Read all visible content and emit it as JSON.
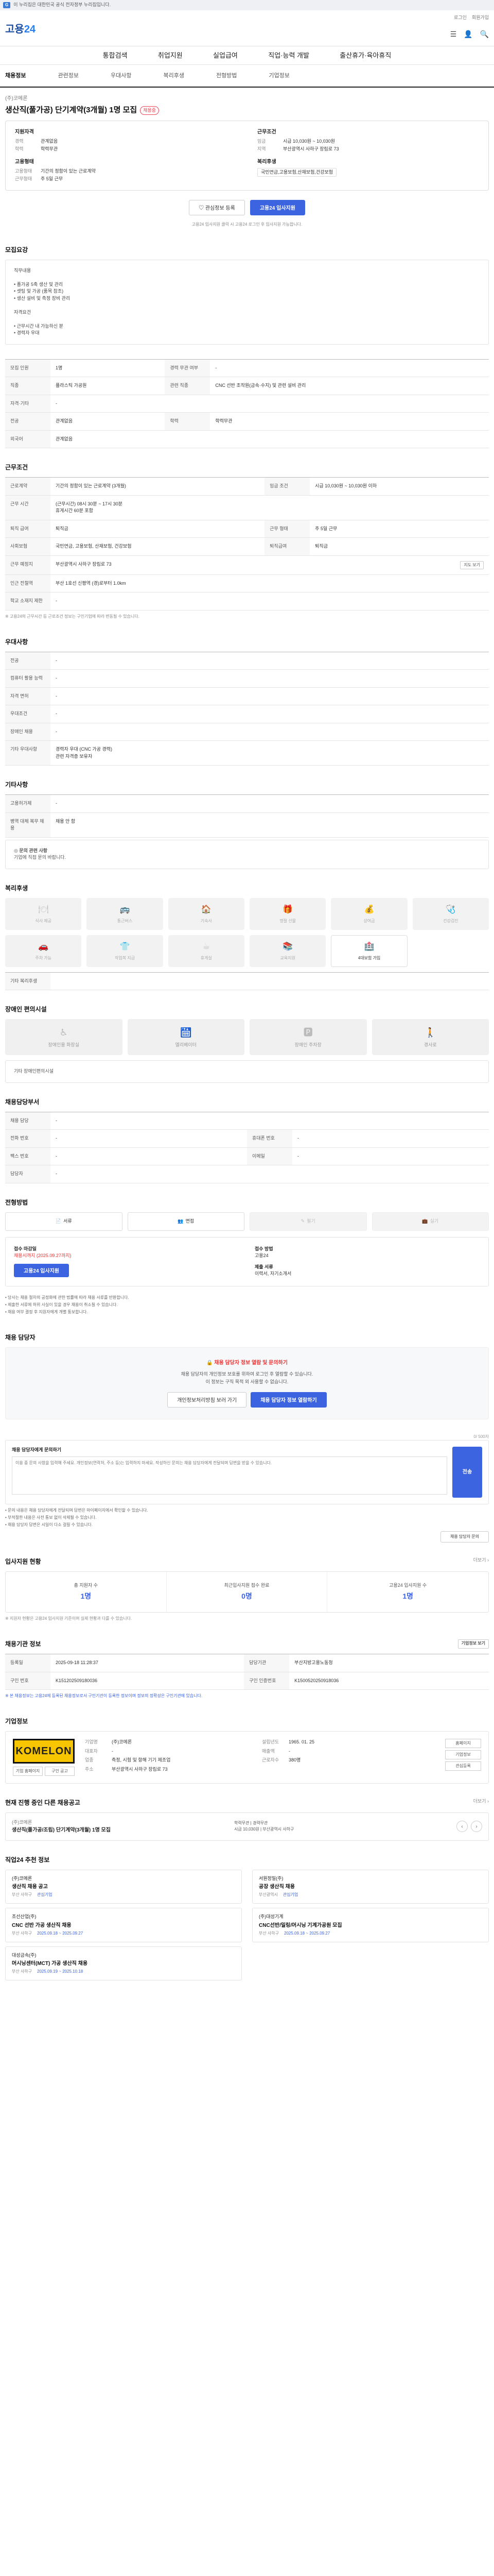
{
  "topbar": {
    "badge": "G",
    "text": "이 누리집은 대한민국 공식 전자정부 누리집입니다."
  },
  "header": {
    "logo_prefix": "고용",
    "logo_suffix": "24",
    "util": [
      "로그인",
      "회원가입"
    ],
    "icons": [
      "☰",
      "👤",
      "🔍"
    ]
  },
  "gnb": [
    "통합검색",
    "취업지원",
    "실업급여",
    "직업·능력 개발",
    "출산휴가·육아휴직"
  ],
  "subnav": [
    "채용정보",
    "관련정보",
    "우대사항",
    "복리후생",
    "전형방법",
    "기업정보"
  ],
  "job": {
    "company": "(주)코메론",
    "tag": "채용중",
    "title": "생산직(풀가공) 단기계약(3개월) 1명 모집",
    "qual_title": "지원자격",
    "qual": [
      [
        "경력",
        "관계없음"
      ],
      [
        "학력",
        "학력무관"
      ]
    ],
    "cond_title": "근무조건",
    "cond": [
      [
        "임금",
        "시급 10,030원 ~ 10,030원"
      ],
      [
        "지역",
        "부산광역시 사하구 장림로 73"
      ]
    ],
    "emp_title": "고용형태",
    "emp": [
      [
        "고용형태",
        "기간의 정함이 있는 근로계약"
      ],
      [
        "근무형태",
        "주 5일 근무"
      ]
    ],
    "welfare_title": "복리후생",
    "welfare": "국민연금,고용보험,산재보험,건강보험"
  },
  "buttons": {
    "scrap": "♡ 관심정보 등록",
    "apply": "고용24 입사지원"
  },
  "apply_note": "고용24 입사지원 클릭 시 고용24 로그인 후 입사지원 가능합니다.",
  "apply_note_link": "고용24 입사지원",
  "sections": {
    "detail": {
      "title": "모집요강",
      "text": "직무내용\n\n• 폴가공 5축 생산 및 관리\n• 셋팅 및 가공 (품목 참조)\n• 생산 설비 및 측정 장비 관리\n\n자격요건\n\n• 근무시간 내 가능하신 분\n• 경력자 우대"
    },
    "summary": {
      "title": "모집요강 요약",
      "rows": [
        [
          "모집 인원",
          "1명",
          "경력 무관 여부",
          "-"
        ],
        [
          "직종",
          "플라스틱 가공원",
          "관련 직종",
          "CNC 선반 조작원(금속·수지) 및 관련 설비 관리"
        ],
        [
          "자격·기타",
          "-",
          "",
          ""
        ],
        [
          "전공",
          "관계없음",
          "학력",
          "학력무관"
        ],
        [
          "외국어",
          "관계없음",
          "",
          ""
        ]
      ]
    },
    "work": {
      "title": "근무조건",
      "rows": [
        [
          "근로계약",
          "기간의 정함이 있는 근로계약 (3개월)",
          "임금 조건",
          "시급 10,030원 ~ 10,030원 이하"
        ],
        [
          "근무 시간",
          "(근무시간) 08시 30분 ~ 17시 30분\n휴게시간 60분 포함",
          "",
          ""
        ],
        [
          "퇴직 급여",
          "퇴직금",
          "근무 형태",
          "주 5일 근무"
        ],
        [
          "사회보험",
          "국민연금, 고용보험, 산재보험, 건강보험",
          "퇴직급여",
          "퇴직금"
        ],
        [
          "근무 예정지",
          "부산광역시 사하구 장림로 73",
          "",
          ""
        ],
        [
          "인근 전철역",
          "부산 1호선 신평역 (경)로부터 1.0km",
          "",
          ""
        ],
        [
          "학교 소재지 제한",
          "-",
          "",
          ""
        ]
      ],
      "map_btn": "지도 보기",
      "note": "※ 고용24의 근무시간 등 근로조건 정보는 구인기업에 따라 변동될 수 있습니다."
    },
    "pref": {
      "title": "우대사항",
      "rows": [
        [
          "전공",
          "-"
        ],
        [
          "컴퓨터 활용 능력",
          "-"
        ],
        [
          "자격 면허",
          "-"
        ],
        [
          "우대조건",
          "-"
        ],
        [
          "장애인 채용",
          "-"
        ],
        [
          "기타 우대사항",
          "경력자 우대 (CNC 가공 경력)\n관련 자격증 보유자"
        ]
      ]
    },
    "etc": {
      "title": "기타사항",
      "rows": [
        [
          "고용허가제",
          "-"
        ],
        [
          "병역 대체 복무 채용",
          "채용 안 함"
        ]
      ],
      "inquiry_title": "◎ 문의 관련 사항",
      "inquiry": "기업에 직접 문의 바랍니다."
    },
    "welfare": {
      "title": "복리후생",
      "items": [
        [
          "🍽",
          "식사 제공",
          false
        ],
        [
          "🚌",
          "통근버스",
          false
        ],
        [
          "🏠",
          "기숙사",
          false
        ],
        [
          "🎁",
          "명절 선물",
          false
        ],
        [
          "💰",
          "상여금",
          false
        ],
        [
          "🩺",
          "건강검진",
          false
        ],
        [
          "🚗",
          "주차 가능",
          false
        ],
        [
          "👕",
          "작업복 지급",
          false
        ],
        [
          "☕",
          "휴게실",
          false
        ],
        [
          "📚",
          "교육지원",
          false
        ],
        [
          "🏥",
          "4대보험 가입",
          true
        ]
      ],
      "other_title": "기타 복리후생"
    },
    "barrier": {
      "title": "장애인 편의시설",
      "items": [
        [
          "♿",
          "장애인용 화장실"
        ],
        [
          "🛗",
          "엘리베이터"
        ],
        [
          "🅿",
          "장애인 주차장"
        ],
        [
          "🚶",
          "경사로"
        ]
      ],
      "other_title": "기타 장애인편의시설"
    },
    "dept": {
      "title": "채용담당부서",
      "rows": [
        [
          "채용 담당",
          "-",
          "",
          ""
        ],
        [
          "전화 번호",
          "-",
          "휴대폰 번호",
          "-"
        ],
        [
          "팩스 번호",
          "-",
          "이메일",
          "-"
        ],
        [
          "담당자",
          "-",
          "",
          ""
        ]
      ]
    },
    "method": {
      "title": "전형방법",
      "buttons": [
        [
          "📄",
          "서류",
          true
        ],
        [
          "👥",
          "면접",
          true
        ],
        [
          "✎",
          "필기",
          false
        ],
        [
          "💼",
          "실기",
          false
        ]
      ],
      "recv_title": "접수 마감일",
      "recv": "채용시까지 (2025.09.27까지)",
      "recv_btn": "고용24 입사지원",
      "doc_title": "접수 방법",
      "doc": "고용24",
      "doc2_title": "제출 서류",
      "doc2": "이력서, 자기소개서",
      "notes": [
        "• 당사는 채용 절차의 공정화에 관한 법률에 따라 채용 서류를 반환합니다.",
        "• 제출한 서류에 허위 사실이 있을 경우 채용이 취소될 수 있습니다.",
        "• 채용 여부 결정 후 지원자에게 개별 통보합니다."
      ]
    },
    "contact": {
      "title": "채용 담당자",
      "lock": "🔒 채용 담당자 정보 열람 및 문의하기",
      "p1": "채용 담당자의 개인정보 보호를 위하여 로그인 후 열람할 수 있습니다.",
      "p2": "이 정보는 구직 목적 외 사용할 수 없습니다.",
      "b1": "개인정보처리방침 보러 가기",
      "b2": "채용 담당자 정보 열람하기"
    },
    "qa": {
      "title": "채용 담당자에게 문의하기",
      "count": "0/ 500자",
      "label": "채용 담당자에게 문의하기",
      "placeholder": "이용 중 문의 사항을 입력해 주세요. 개인정보(연락처, 주소 등)는 입력하지 마세요. 작성하신 문의는 채용 담당자에게 전달되며 답변을 받을 수 있습니다.",
      "send": "전송",
      "notes": [
        "• 문의 내용은 채용 담당자에게 전달되며 답변은 마이페이지에서 확인할 수 있습니다.",
        "• 부적절한 내용은 사전 통보 없이 삭제될 수 있습니다.",
        "• 채용 담당자 답변은 시일이 다소 걸릴 수 있습니다."
      ],
      "btn": "채용 담당자 문의"
    },
    "stats": {
      "title": "입사지원 현황",
      "more": "더보기 ›",
      "items": [
        [
          "총 지원자 수",
          "1명"
        ],
        [
          "최근입사지원 접수 완료",
          "0명"
        ],
        [
          "고용24 입사지원 수",
          "1명"
        ]
      ],
      "note": "※ 지원자 현황은 고용24 입사지원 기준이며 실제 현황과 다를 수 있습니다."
    },
    "info": {
      "title": "채용기관 정보",
      "btn": "기업정보 보기",
      "rows": [
        [
          "등록일",
          "2025-09-18 11:28:37",
          "담당기관",
          "부산지방고용노동청"
        ],
        [
          "구인 번호",
          "K151202509180036",
          "구인 인증번호",
          "K1500520250918036"
        ]
      ],
      "note": "※ 본 채용정보는 고용24에 등록된 채용정보로서 구인기관이 등록한 정보이며 정보의 정확성은 구인기관에 있습니다."
    },
    "company": {
      "title": "기업정보",
      "logo": "KOMELON",
      "mini": [
        "기업 홈페이지",
        "구인 공고"
      ],
      "rows": [
        [
          "기업명",
          "(주)코메론",
          "설립년도",
          "1965. 01. 25"
        ],
        [
          "대표자",
          "-",
          "매출액",
          "-"
        ],
        [
          "업종",
          "측정, 시험 및 항해 기기 제조업",
          "근로자수",
          "380명"
        ],
        [
          "주소",
          "부산광역시 사하구 장림로 73",
          "",
          ""
        ]
      ],
      "side": [
        "홈페이지",
        "기업정보",
        "관심등록"
      ]
    },
    "other": {
      "title": "현재 진행 중인 다른 채용공고",
      "more": "더보기 ›",
      "company": "(주)코메론",
      "job": "생산직(폴가공/조립) 단기계약(3개월) 1명 모집",
      "meta": [
        "학력무관  |  경력무관",
        "시급 10,030원  |  부산광역시 사하구"
      ]
    },
    "recommend": {
      "title": "직업24 추천 정보",
      "items": [
        [
          "(주)코메론",
          "생산직 채용 공고",
          "부산 사하구",
          "관심기업"
        ],
        [
          "서원정밀(주)",
          "공장 생산직 채용",
          "부산광역시",
          "관심기업"
        ],
        [
          "조선산업(주)",
          "CNC 선반 가공 생산직 채용",
          "부산 사하구",
          "2025.09.18 ~ 2025.09.27"
        ],
        [
          "(주)대성기계",
          "CNC선반/밀링/머시닝 기계가공원 모집",
          "부산 사하구",
          "2025.09.18 ~ 2025.09.27"
        ],
        [
          "대성금속(주)",
          "머시닝센터(MCT) 가공 생산직 채용",
          "부산 사하구",
          "2025.09.19 ~ 2025.10.18"
        ]
      ]
    }
  }
}
